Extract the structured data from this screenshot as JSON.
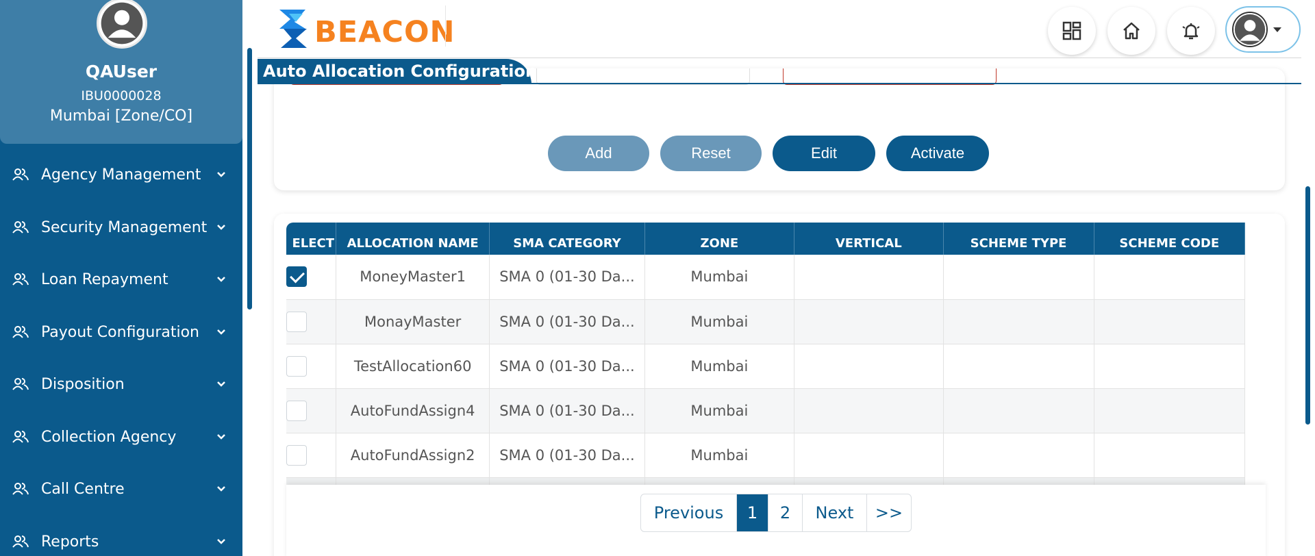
{
  "brand": {
    "name": "BEACON"
  },
  "user": {
    "name": "QAUser",
    "id": "IBU0000028",
    "zone": "Mumbai [Zone/CO]"
  },
  "sidebar": {
    "items": [
      {
        "label": "Agency Management",
        "icon": "users-icon"
      },
      {
        "label": "Security Management",
        "icon": "users-icon"
      },
      {
        "label": "Loan Repayment",
        "icon": "users-icon"
      },
      {
        "label": "Payout Configuration",
        "icon": "users-icon"
      },
      {
        "label": "Disposition",
        "icon": "users-icon"
      },
      {
        "label": "Collection Agency",
        "icon": "users-icon"
      },
      {
        "label": "Call Centre",
        "icon": "users-icon"
      },
      {
        "label": "Reports",
        "icon": "users-icon"
      }
    ]
  },
  "header": {
    "icons": [
      "dashboard-icon",
      "home-icon",
      "bell-icon",
      "user-avatar-icon"
    ]
  },
  "page": {
    "title": "Auto Allocation Configuration"
  },
  "actions": {
    "add": "Add",
    "reset": "Reset",
    "edit": "Edit",
    "activate": "Activate"
  },
  "table": {
    "columns": [
      "ELECT",
      "ALLOCATION NAME",
      "SMA CATEGORY",
      "ZONE",
      "VERTICAL",
      "SCHEME TYPE",
      "SCHEME CODE"
    ],
    "rows": [
      {
        "selected": true,
        "name": "MoneyMaster1",
        "sma": "SMA 0 (01-30 Da...",
        "zone": "Mumbai",
        "vertical": "",
        "scheme_type": "",
        "scheme_code": ""
      },
      {
        "selected": false,
        "name": "MonayMaster",
        "sma": "SMA 0 (01-30 Da...",
        "zone": "Mumbai",
        "vertical": "",
        "scheme_type": "",
        "scheme_code": ""
      },
      {
        "selected": false,
        "name": "TestAllocation60",
        "sma": "SMA 0 (01-30 Da...",
        "zone": "Mumbai",
        "vertical": "",
        "scheme_type": "",
        "scheme_code": ""
      },
      {
        "selected": false,
        "name": "AutoFundAssign4",
        "sma": "SMA 0 (01-30 Da...",
        "zone": "Mumbai",
        "vertical": "",
        "scheme_type": "",
        "scheme_code": ""
      },
      {
        "selected": false,
        "name": "AutoFundAssign2",
        "sma": "SMA 0 (01-30 Da...",
        "zone": "Mumbai",
        "vertical": "",
        "scheme_type": "",
        "scheme_code": ""
      }
    ]
  },
  "pagination": {
    "previous": "Previous",
    "pages": [
      "1",
      "2"
    ],
    "current": "1",
    "next": "Next",
    "last": ">>"
  },
  "colors": {
    "primary": "#0b5a8c",
    "profile_bg": "#3e7ea7",
    "accent_orange": "#f58220",
    "disabled_button": "#6a98b9"
  }
}
